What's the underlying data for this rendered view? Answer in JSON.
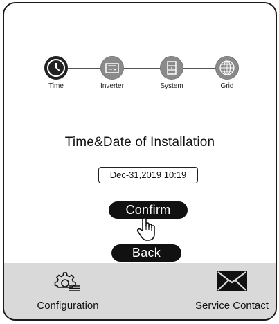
{
  "steps": [
    {
      "label": "Time",
      "icon": "clock-icon",
      "active": true
    },
    {
      "label": "Inverter",
      "icon": "inverter-icon",
      "active": false
    },
    {
      "label": "System",
      "icon": "system-icon",
      "active": false
    },
    {
      "label": "Grid",
      "icon": "globe-icon",
      "active": false
    }
  ],
  "title": "Time&Date of Installation",
  "datetime_value": "Dec-31,2019 10:19",
  "confirm_label": "Confirm",
  "back_label": "Back",
  "bottom_nav": {
    "configuration_label": "Configuration",
    "service_label": "Service Contact"
  }
}
